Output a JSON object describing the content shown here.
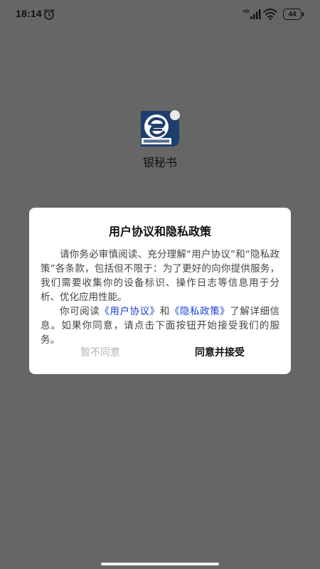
{
  "status_bar": {
    "time": "18:14",
    "battery": "44",
    "icons": [
      "alarm-icon",
      "signal-icon",
      "wifi-icon",
      "battery-icon"
    ]
  },
  "app": {
    "logo_icon": "bank-payment-logo",
    "name": "银秘书"
  },
  "dialog": {
    "title": "用户协议和隐私政策",
    "para1": "请你务必审慎阅读、充分理解“用户协议”和“隐私政策”各条款，包括但不限于：为了更好的向你提供服务，我们需要收集你的设备标识、操作日志等信息用于分析、优化应用性能。",
    "para2_prefix": "你可阅读",
    "link_user_agreement": "《用户协议》",
    "para2_and": "和",
    "link_privacy_policy": "《隐私政策》",
    "para2_suffix": "了解详细信息。如果你同意，请点击下面按钮开始接受我们的服务。",
    "decline_label": "暂不同意",
    "accept_label": "同意并接受"
  },
  "colors": {
    "overlay": "#666666",
    "dialog_bg": "#ffffff",
    "link": "#1a3fd8",
    "decline_text": "#b4b4b4",
    "body_text": "#444444"
  }
}
